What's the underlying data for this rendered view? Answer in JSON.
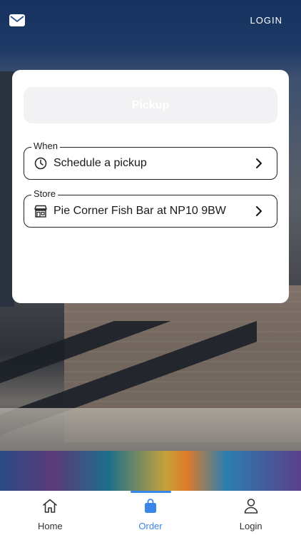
{
  "header": {
    "login_label": "LOGIN",
    "mail_icon": "mail-icon"
  },
  "card": {
    "mode_tab_label": "Pickup",
    "when": {
      "legend": "When",
      "value": "Schedule a pickup",
      "icon": "clock-icon"
    },
    "store": {
      "legend": "Store",
      "value": "Pie Corner Fish Bar at NP10 9BW",
      "icon": "storefront-icon"
    }
  },
  "bottom_nav": {
    "active_color": "#3a86e8",
    "items": [
      {
        "label": "Home",
        "icon": "home-icon",
        "active": false
      },
      {
        "label": "Order",
        "icon": "shopping-bag-icon",
        "active": true
      },
      {
        "label": "Login",
        "icon": "user-icon",
        "active": false
      }
    ]
  }
}
